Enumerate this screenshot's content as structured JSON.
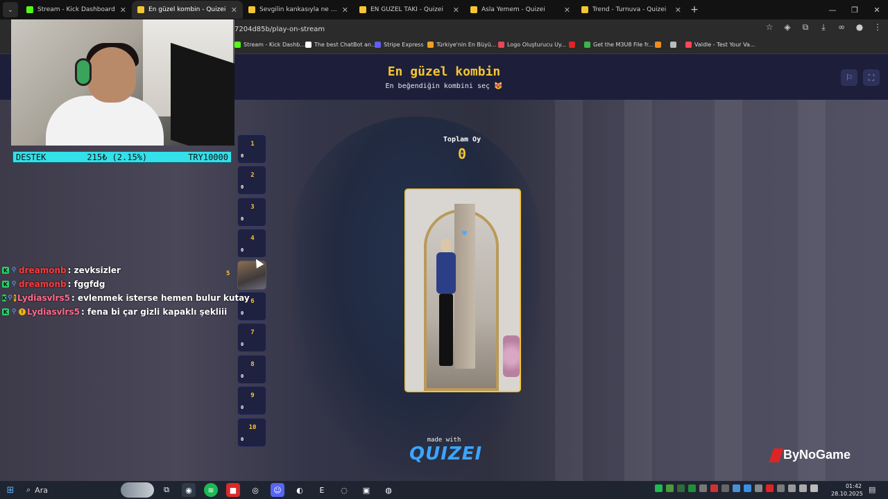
{
  "browser": {
    "tabs": [
      {
        "title": "Stream - Kick Dashboard",
        "active": false,
        "color": "#53fc18"
      },
      {
        "title": "En güzel kombin - Quizei",
        "active": true,
        "color": "#f5c633"
      },
      {
        "title": "Sevgilin kankasıyla ne yapamaz",
        "active": false,
        "color": "#f5c633"
      },
      {
        "title": "EN GÜZEL TAKI - Quizei",
        "active": false,
        "color": "#f5c633"
      },
      {
        "title": "Asla Yemem - Quizei",
        "active": false,
        "color": "#f5c633"
      },
      {
        "title": "Trend - Turnuva - Quizei",
        "active": false,
        "color": "#f5c633"
      }
    ],
    "url": "7204d85b/play-on-stream",
    "bookmarks": [
      {
        "label": "Stream - Kick Dashb...",
        "color": "#53fc18"
      },
      {
        "label": "The best ChatBot an...",
        "color": "#ffffff"
      },
      {
        "label": "Stripe Express",
        "color": "#635bff"
      },
      {
        "label": "Türkiye'nin En Büyü...",
        "color": "#f0a020"
      },
      {
        "label": "Logo Oluşturucu Uy...",
        "color": "#e8465c"
      },
      {
        "label": "",
        "color": "#e02424"
      },
      {
        "label": "Get the M3U8 File fr...",
        "color": "#3bb54a"
      },
      {
        "label": "",
        "color": "#f08a24"
      },
      {
        "label": "",
        "color": "#bbbbbb"
      },
      {
        "label": "Valdle - Test Your Va...",
        "color": "#ff4655"
      }
    ]
  },
  "quiz": {
    "title": "En güzel kombin",
    "subtitle": "En beğendiğin kombini seç 😻",
    "total_label": "Toplam Oy",
    "total_value": "0",
    "slots": [
      {
        "num": "1",
        "count": "0"
      },
      {
        "num": "2",
        "count": "0"
      },
      {
        "num": "3",
        "count": "0"
      },
      {
        "num": "4",
        "count": "0"
      },
      {
        "num": "5",
        "count": ""
      },
      {
        "num": "6",
        "count": "0"
      },
      {
        "num": "7",
        "count": "0"
      },
      {
        "num": "8",
        "count": "0"
      },
      {
        "num": "9",
        "count": "0"
      },
      {
        "num": "10",
        "count": "0"
      }
    ],
    "made_with": "made with",
    "brand": "QUIZEI"
  },
  "overlay": {
    "support_label": "DESTEK",
    "support_amount": "215₺ (2.15%)",
    "support_goal": "TRY10000",
    "sponsor": "ByNoGame"
  },
  "chat": [
    {
      "user": "dreamonb",
      "message": ": zevksizler",
      "user_color": "#ff3b3b",
      "sub": false
    },
    {
      "user": "dreamonb",
      "message": ": fggfdg",
      "user_color": "#ff3b3b",
      "sub": false
    },
    {
      "user": "Lydiasvlrs5",
      "message": ": evlenmek isterse hemen bulur kutay",
      "user_color": "#ff6b8b",
      "sub": true
    },
    {
      "user": "Lydiasvlrs5",
      "message": ": fena bi çar gizli kapaklı şekliii",
      "user_color": "#ff6b8b",
      "sub": true
    }
  ],
  "taskbar": {
    "search_label": "Ara",
    "time": "01:42",
    "date": "28.10.2025"
  }
}
